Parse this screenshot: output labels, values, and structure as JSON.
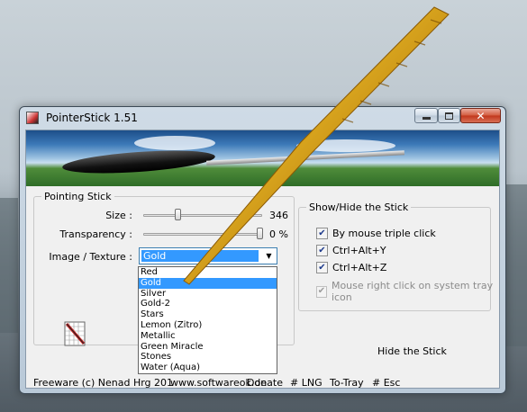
{
  "window": {
    "title": "PointerStick 1.51"
  },
  "pointing_group": {
    "legend": "Pointing Stick",
    "size_label": "Size :",
    "size_value": "346",
    "size_fraction": 0.29,
    "transparency_label": "Transparency :",
    "transparency_value": "0 %",
    "transparency_fraction": 0.98,
    "texture_label": "Image / Texture :",
    "texture_selected": "Gold",
    "texture_options": [
      "Red",
      "Gold",
      "Silver",
      "Gold-2",
      "Stars",
      "Lemon (Zitro)",
      "Metallic",
      "Green Miracle",
      "Stones",
      "Water (Aqua)"
    ]
  },
  "showhide_group": {
    "legend": "Show/Hide the Stick",
    "options": [
      {
        "label": "By mouse triple click",
        "checked": true,
        "enabled": true
      },
      {
        "label": "Ctrl+Alt+Y",
        "checked": true,
        "enabled": true
      },
      {
        "label": "Ctrl+Alt+Z",
        "checked": true,
        "enabled": true
      },
      {
        "label": "Mouse right click on system tray icon",
        "checked": true,
        "enabled": false
      }
    ]
  },
  "hide_stick_label": "Hide the Stick",
  "footer": {
    "copyright": "Freeware (c) Nenad Hrg 201",
    "url": "www.softwareok.de",
    "donate": "Donate",
    "lng": "# LNG",
    "tray": "To-Tray",
    "esc": "# Esc"
  },
  "colors": {
    "selection": "#3399ff",
    "gold": "#e6b422"
  },
  "icons": {
    "app": "pointerstick-icon",
    "texture": "texture-grid-icon"
  }
}
